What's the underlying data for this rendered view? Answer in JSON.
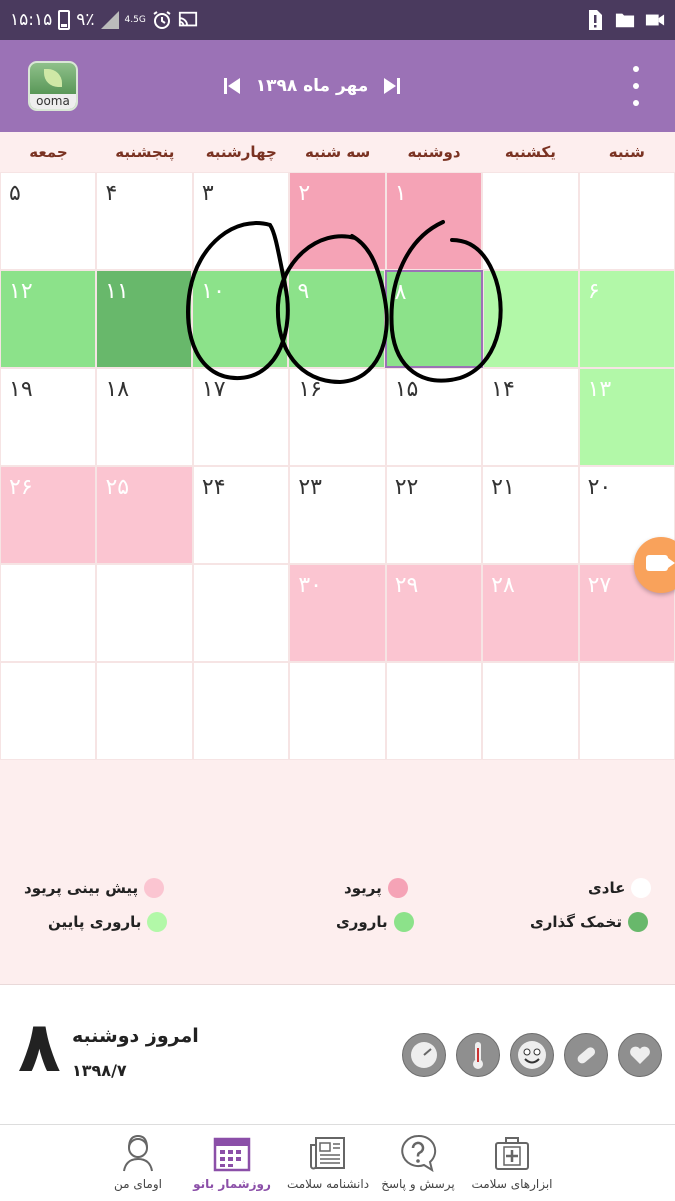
{
  "status_bar": {
    "time": "۱۵:۱۵",
    "battery": "۹٪",
    "network": "4.5G"
  },
  "header": {
    "logo_text": "ooma",
    "month_title": "مهر ماه ۱۳۹۸"
  },
  "weekdays": [
    "شنبه",
    "یکشنبه",
    "دوشنبه",
    "سه شنبه",
    "چهارشنبه",
    "پنجشنبه",
    "جمعه"
  ],
  "calendar": {
    "rows": [
      [
        {
          "day": "",
          "type": "empty"
        },
        {
          "day": "",
          "type": "empty"
        },
        {
          "day": "۱",
          "type": "period"
        },
        {
          "day": "۲",
          "type": "period"
        },
        {
          "day": "۳",
          "type": "normal"
        },
        {
          "day": "۴",
          "type": "normal"
        },
        {
          "day": "۵",
          "type": "normal"
        }
      ],
      [
        {
          "day": "۶",
          "type": "fertile-low"
        },
        {
          "day": "",
          "type": "fertile-low"
        },
        {
          "day": "۸",
          "type": "fertile",
          "today": true
        },
        {
          "day": "۹",
          "type": "fertile"
        },
        {
          "day": "۱۰",
          "type": "fertile"
        },
        {
          "day": "۱۱",
          "type": "ovulation"
        },
        {
          "day": "۱۲",
          "type": "fertile"
        }
      ],
      [
        {
          "day": "۱۳",
          "type": "fertile-low"
        },
        {
          "day": "۱۴",
          "type": "normal"
        },
        {
          "day": "۱۵",
          "type": "normal"
        },
        {
          "day": "۱۶",
          "type": "normal"
        },
        {
          "day": "۱۷",
          "type": "normal"
        },
        {
          "day": "۱۸",
          "type": "normal"
        },
        {
          "day": "۱۹",
          "type": "normal"
        }
      ],
      [
        {
          "day": "۲۰",
          "type": "normal"
        },
        {
          "day": "۲۱",
          "type": "normal"
        },
        {
          "day": "۲۲",
          "type": "normal"
        },
        {
          "day": "۲۳",
          "type": "normal"
        },
        {
          "day": "۲۴",
          "type": "normal"
        },
        {
          "day": "۲۵",
          "type": "period-forecast"
        },
        {
          "day": "۲۶",
          "type": "period-forecast"
        }
      ],
      [
        {
          "day": "۲۷",
          "type": "period-forecast"
        },
        {
          "day": "۲۸",
          "type": "period-forecast"
        },
        {
          "day": "۲۹",
          "type": "period-forecast"
        },
        {
          "day": "۳۰",
          "type": "period-forecast"
        },
        {
          "day": "",
          "type": "empty"
        },
        {
          "day": "",
          "type": "empty"
        },
        {
          "day": "",
          "type": "empty"
        }
      ],
      [
        {
          "day": "",
          "type": "empty"
        },
        {
          "day": "",
          "type": "empty"
        },
        {
          "day": "",
          "type": "empty"
        },
        {
          "day": "",
          "type": "empty"
        },
        {
          "day": "",
          "type": "empty"
        },
        {
          "day": "",
          "type": "empty"
        },
        {
          "day": "",
          "type": "empty"
        }
      ]
    ]
  },
  "legend": {
    "normal": "عادی",
    "period": "پریود",
    "period_forecast": "پیش بینی پریود",
    "ovulation": "تخمک گذاری",
    "fertile": "باروری",
    "fertile_low": "باروری پایین"
  },
  "today": {
    "day": "۸",
    "label": "امروز دوشنبه",
    "date": "۱۳۹۸/۷"
  },
  "bottom_nav": {
    "items": [
      {
        "label": "اومای من",
        "icon": "woman-icon"
      },
      {
        "label": "روزشمار بانو",
        "icon": "calendar-icon",
        "active": true
      },
      {
        "label": "دانشنامه سلامت",
        "icon": "newspaper-icon"
      },
      {
        "label": "پرسش و پاسخ",
        "icon": "question-icon"
      },
      {
        "label": "ابزارهای سلامت",
        "icon": "medical-kit-icon"
      }
    ]
  },
  "colors": {
    "header": "#9b72b6",
    "status_bar": "#4a3a5e",
    "period": "#f5a3b6",
    "period_forecast": "#fbc5d1",
    "fertile": "#8ce28a",
    "fertile_low": "#b2f8a8",
    "ovulation": "#68b86b",
    "normal": "#ffffff",
    "weekday_text": "#7a3222",
    "active_nav": "#8b4fa8"
  }
}
